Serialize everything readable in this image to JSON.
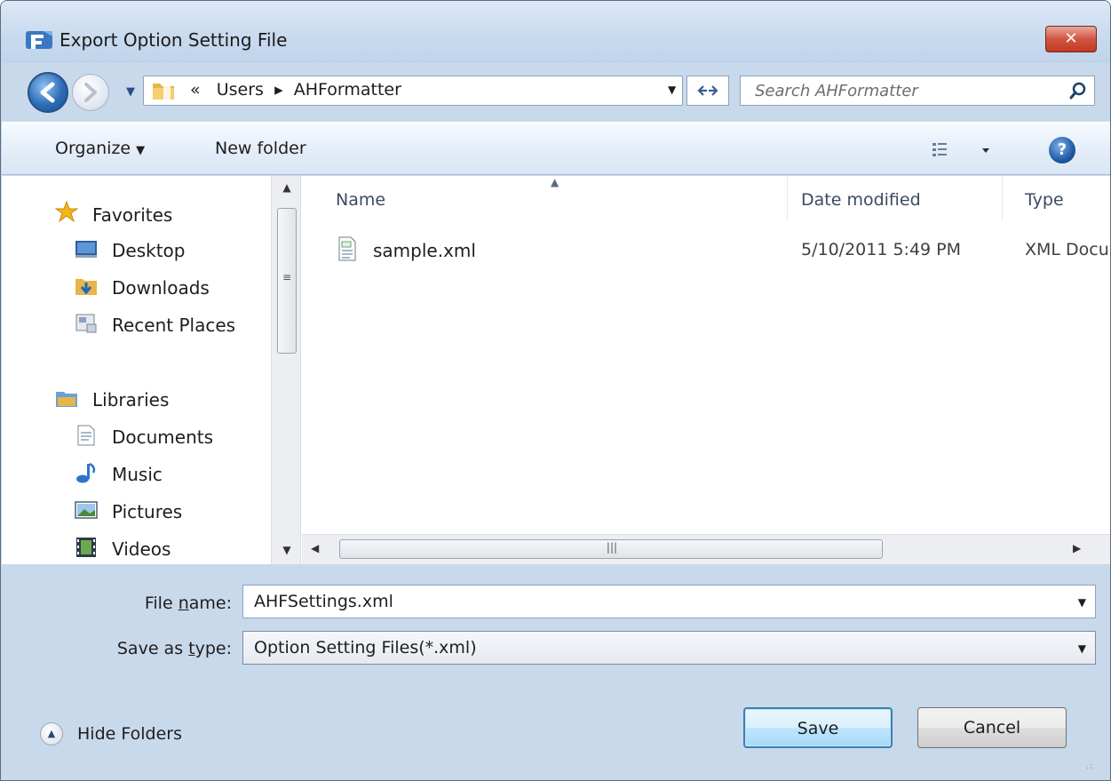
{
  "window": {
    "title": "Export Option Setting File",
    "close_label": "✕"
  },
  "navigation": {
    "breadcrumb_overflow": "«",
    "breadcrumb_separator": "▸",
    "path": [
      "Users",
      "AHFormatter"
    ],
    "search_placeholder": "Search AHFormatter"
  },
  "toolbar": {
    "organize_label": "Organize",
    "new_folder_label": "New folder",
    "help_label": "?"
  },
  "sidebar": {
    "favorites": {
      "label": "Favorites",
      "items": [
        {
          "label": "Desktop",
          "icon": "desktop-icon"
        },
        {
          "label": "Downloads",
          "icon": "downloads-icon"
        },
        {
          "label": "Recent Places",
          "icon": "recent-places-icon"
        }
      ]
    },
    "libraries": {
      "label": "Libraries",
      "items": [
        {
          "label": "Documents",
          "icon": "documents-icon"
        },
        {
          "label": "Music",
          "icon": "music-icon"
        },
        {
          "label": "Pictures",
          "icon": "pictures-icon"
        },
        {
          "label": "Videos",
          "icon": "videos-icon"
        }
      ]
    }
  },
  "file_list": {
    "columns": [
      "Name",
      "Date modified",
      "Type"
    ],
    "rows": [
      {
        "name": "sample.xml",
        "date_modified": "5/10/2011 5:49 PM",
        "type": "XML Docu"
      }
    ]
  },
  "form": {
    "file_name_label_pre": "File ",
    "file_name_label_u": "n",
    "file_name_label_post": "ame:",
    "file_name_value": "AHFSettings.xml",
    "save_type_label_pre": "Save as ",
    "save_type_label_u": "t",
    "save_type_label_post": "ype:",
    "save_type_value": "Option Setting Files(*.xml)"
  },
  "footer": {
    "hide_folders_label": "Hide Folders",
    "save_label": "Save",
    "cancel_label": "Cancel"
  },
  "colors": {
    "window_frame": "#c9d9ec",
    "close_button": "#c13a22",
    "accent": "#3c7fb1"
  }
}
